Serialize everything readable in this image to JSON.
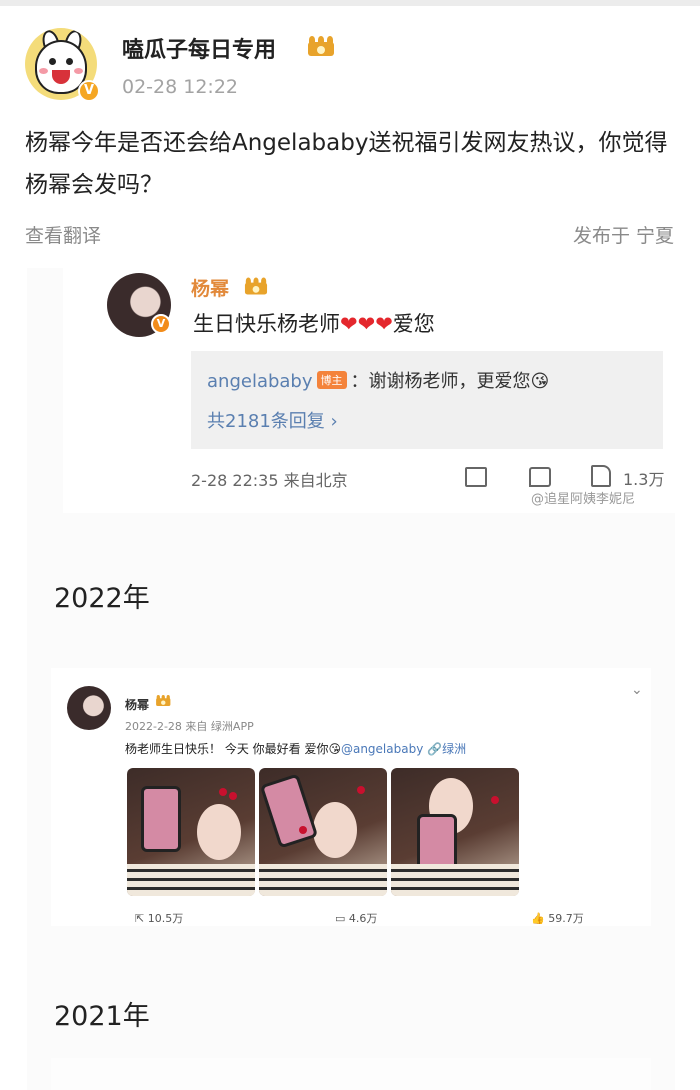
{
  "post": {
    "username": "嗑瓜子每日专用",
    "timestamp": "02-28 12:22",
    "text": "杨幂今年是否还会给Angelababy送祝福引发网友热议，你觉得杨幂会发吗？",
    "translate_label": "查看翻译",
    "location": "发布于 宁夏",
    "verified_badge": "V"
  },
  "screenshot_2023": {
    "name": "杨幂",
    "text": "生日快乐杨老师",
    "hearts": "❤❤❤",
    "text_tail": "爱您",
    "reply_user": "angelababy",
    "reply_badge": "博主",
    "reply_text": "：谢谢杨老师，更爱您",
    "reply_emoji": "😘",
    "reply_count": "共2181条回复 ›",
    "meta": "2-28 22:35 来自北京",
    "likes": "1.3万",
    "watermark": "@追星阿姨李妮尼"
  },
  "year_2022": "2022年",
  "screenshot_2022": {
    "name": "杨幂",
    "meta": "2022-2-28 来自 绿洲APP",
    "text": "杨老师生日快乐！ 今天 你最好看 爱你",
    "emoji": "😘",
    "mention": "@angelababy",
    "oasis": "🔗绿洲",
    "reposts": "10.5万",
    "comments": "4.6万",
    "likes": "59.7万"
  },
  "year_2021": "2021年",
  "colors": {
    "accent_orange": "#e2893a",
    "link_blue": "#5a7fb0",
    "heart_red": "#e4272d",
    "muted_text": "#8a8a8a"
  },
  "icons": [
    "verified-icon",
    "crown-icon",
    "share-icon",
    "comment-icon",
    "like-icon",
    "chevron-down-icon"
  ]
}
